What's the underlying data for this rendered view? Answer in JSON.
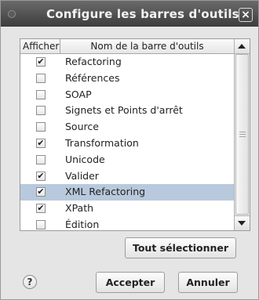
{
  "window": {
    "title": "Configure les barres d'outils",
    "close_symbol": "×"
  },
  "table": {
    "col_show": "Afficher",
    "col_name": "Nom de la barre d'outils",
    "rows": [
      {
        "label": "Refactoring",
        "checked": true,
        "selected": false
      },
      {
        "label": "Références",
        "checked": false,
        "selected": false
      },
      {
        "label": "SOAP",
        "checked": false,
        "selected": false
      },
      {
        "label": "Signets et Points d'arrêt",
        "checked": false,
        "selected": false
      },
      {
        "label": "Source",
        "checked": false,
        "selected": false
      },
      {
        "label": "Transformation",
        "checked": true,
        "selected": false
      },
      {
        "label": "Unicode",
        "checked": false,
        "selected": false
      },
      {
        "label": "Valider",
        "checked": true,
        "selected": false
      },
      {
        "label": "XML Refactoring",
        "checked": true,
        "selected": true
      },
      {
        "label": "XPath",
        "checked": true,
        "selected": false
      },
      {
        "label": "Édition",
        "checked": false,
        "selected": false
      }
    ]
  },
  "buttons": {
    "select_all": "Tout sélectionner",
    "accept": "Accepter",
    "cancel": "Annuler",
    "help": "?"
  },
  "colors": {
    "selection": "#b8c9dd",
    "titlebar": "#4a4a4a"
  }
}
